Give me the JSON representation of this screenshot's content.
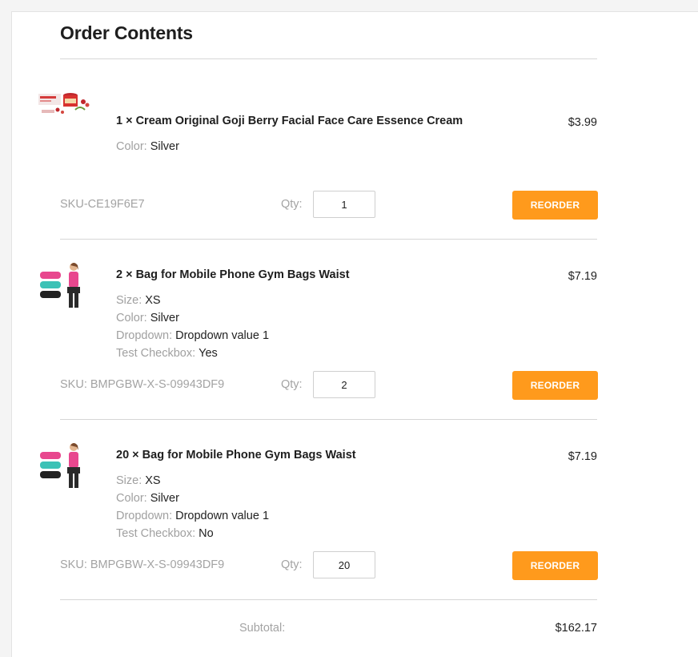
{
  "header": {
    "title": "Order Contents"
  },
  "labels": {
    "sku": "SKU:",
    "qty": "Qty:",
    "reorder": "REORDER"
  },
  "colors": {
    "accent": "#ff9a1c",
    "muted_text": "#a3a3a3",
    "divider": "#d6d6d6"
  },
  "items": [
    {
      "name": "1 × Cream Original Goji Berry Facial Face Care Essence Cream",
      "price": "$3.99",
      "image": "goji-berry-cream-product-image",
      "options": [
        {
          "key": "Color:",
          "value": "Silver"
        }
      ],
      "sku": "SKU-CE19F6E7",
      "qty": "1"
    },
    {
      "name": "2 × Bag for Mobile Phone Gym Bags Waist",
      "price": "$7.19",
      "image": "gym-waist-bag-product-image",
      "options": [
        {
          "key": "Size:",
          "value": "XS"
        },
        {
          "key": "Color:",
          "value": "Silver"
        },
        {
          "key": "Dropdown:",
          "value": "Dropdown value 1"
        },
        {
          "key": "Test Checkbox:",
          "value": "Yes"
        }
      ],
      "sku": "BMPGBW-X-S-09943DF9",
      "qty": "2"
    },
    {
      "name": "20 × Bag for Mobile Phone Gym Bags Waist",
      "price": "$7.19",
      "image": "gym-waist-bag-product-image",
      "options": [
        {
          "key": "Size:",
          "value": "XS"
        },
        {
          "key": "Color:",
          "value": "Silver"
        },
        {
          "key": "Dropdown:",
          "value": "Dropdown value 1"
        },
        {
          "key": "Test Checkbox:",
          "value": "No"
        }
      ],
      "sku": "BMPGBW-X-S-09943DF9",
      "qty": "20"
    }
  ],
  "summary": {
    "subtotal_label": "Subtotal:",
    "subtotal_value": "$162.17"
  }
}
